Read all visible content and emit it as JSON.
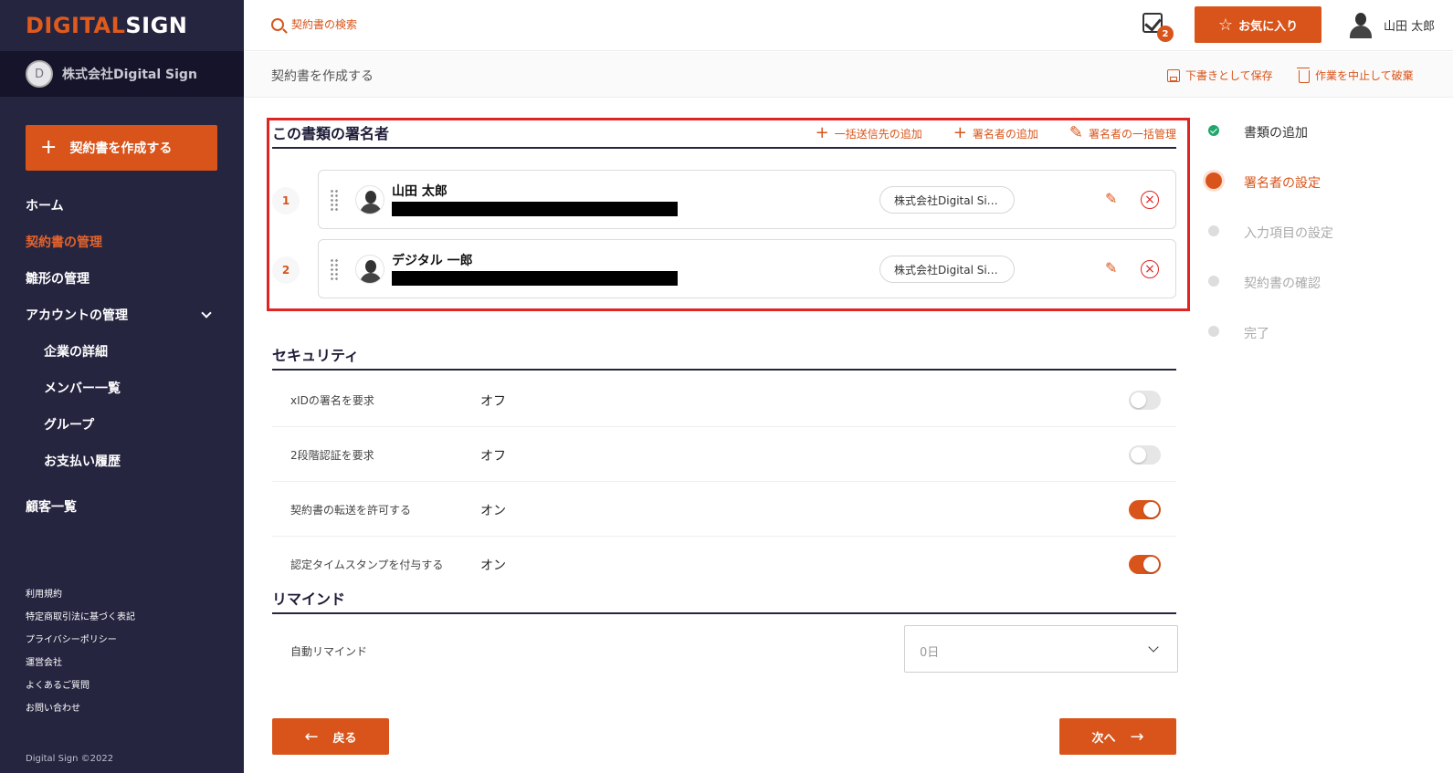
{
  "brand": {
    "logo_part1": "DIGITAL",
    "logo_part2": "SIGN",
    "company": "株式会社Digital Sign",
    "company_initial": "D"
  },
  "sidebar": {
    "create_button": "契約書を作成する",
    "items": [
      {
        "label": "ホーム"
      },
      {
        "label": "契約書の管理",
        "active": true
      },
      {
        "label": "雛形の管理"
      },
      {
        "label": "アカウントの管理"
      },
      {
        "label": "企業の詳細"
      },
      {
        "label": "メンバー一覧"
      },
      {
        "label": "グループ"
      },
      {
        "label": "お支払い履歴"
      },
      {
        "label": "顧客一覧"
      }
    ],
    "footer_links": [
      "利用規約",
      "特定商取引法に基づく表記",
      "プライバシーポリシー",
      "運営会社",
      "よくあるご質問",
      "お問い合わせ"
    ],
    "copyright": "Digital Sign ©2022"
  },
  "header": {
    "search_placeholder": "契約書の検索",
    "task_badge": "2",
    "favorites_button": "お気に入り",
    "user_name": "山田 太郎"
  },
  "subheader": {
    "title": "契約書を作成する",
    "save_draft": "下書きとして保存",
    "cancel_work": "作業を中止して破棄"
  },
  "signers": {
    "heading": "この書類の署名者",
    "actions": {
      "bulk_add": "一括送信先の追加",
      "add_signer": "署名者の追加",
      "bulk_manage": "署名者の一括管理"
    },
    "list": [
      {
        "number": "1",
        "name": "山田 太郎",
        "org": "株式会社Digital Si…"
      },
      {
        "number": "2",
        "name": "デジタル 一郎",
        "org": "株式会社Digital Si…"
      }
    ]
  },
  "security": {
    "heading": "セキュリティ",
    "rows": [
      {
        "label": "xIDの署名を要求",
        "value": "オフ",
        "on": false
      },
      {
        "label": "2段階認証を要求",
        "value": "オフ",
        "on": false
      },
      {
        "label": "契約書の転送を許可する",
        "value": "オン",
        "on": true
      },
      {
        "label": "認定タイムスタンプを付与する",
        "value": "オン",
        "on": true
      }
    ]
  },
  "remind": {
    "heading": "リマインド",
    "label": "自動リマインド",
    "selected": "0日"
  },
  "nav_buttons": {
    "back": "戻る",
    "next": "次へ"
  },
  "steps": [
    {
      "label": "書類の追加",
      "state": "done"
    },
    {
      "label": "署名者の設定",
      "state": "current"
    },
    {
      "label": "入力項目の設定",
      "state": "todo"
    },
    {
      "label": "契約書の確認",
      "state": "todo"
    },
    {
      "label": "完了",
      "state": "todo"
    }
  ],
  "colors": {
    "accent": "#d9541a",
    "sidebar": "#262540",
    "highlight": "#e02424",
    "success": "#21a66e"
  }
}
